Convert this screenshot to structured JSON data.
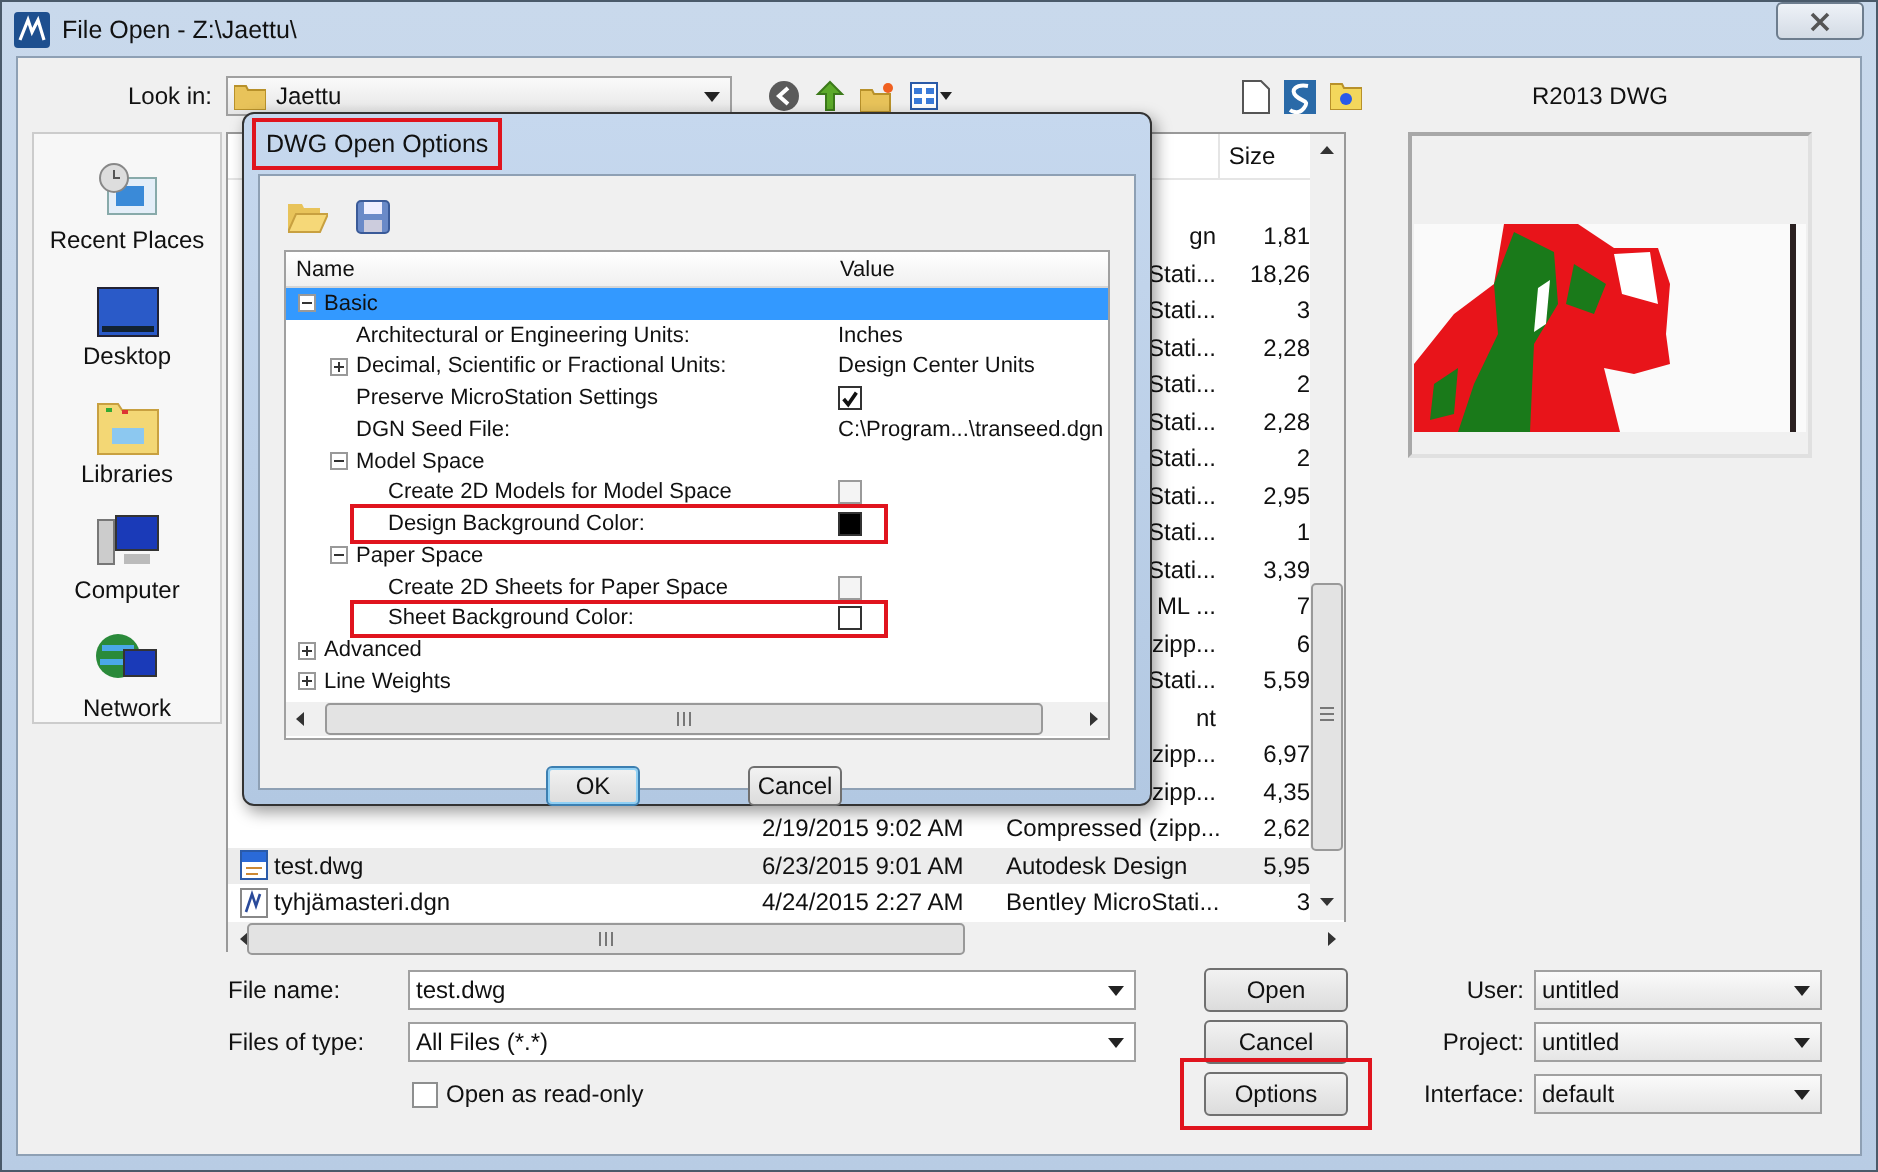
{
  "window": {
    "title": "File Open - Z:\\Jaettu\\"
  },
  "toolbar": {
    "look_in_label": "Look in:",
    "look_in_value": "Jaettu"
  },
  "places": [
    {
      "label": "Recent Places",
      "kind": "recent"
    },
    {
      "label": "Desktop",
      "kind": "desktop"
    },
    {
      "label": "Libraries",
      "kind": "libraries"
    },
    {
      "label": "Computer",
      "kind": "computer"
    },
    {
      "label": "Network",
      "kind": "network"
    }
  ],
  "file_list": {
    "size_column": "Size",
    "rows": [
      {
        "kind": "covered",
        "type": "gn",
        "size": "1,81",
        "selected": false
      },
      {
        "kind": "covered",
        "type": "Stati...",
        "size": "18,26",
        "selected": false
      },
      {
        "kind": "covered",
        "type": "Stati...",
        "size": "3",
        "selected": false
      },
      {
        "kind": "covered",
        "type": "Stati...",
        "size": "2,28",
        "selected": false
      },
      {
        "kind": "covered",
        "type": "Stati...",
        "size": "2",
        "selected": false
      },
      {
        "kind": "covered",
        "type": "Stati...",
        "size": "2,28",
        "selected": false
      },
      {
        "kind": "covered",
        "type": "Stati...",
        "size": "2",
        "selected": false
      },
      {
        "kind": "covered",
        "type": "Stati...",
        "size": "2,95",
        "selected": false
      },
      {
        "kind": "covered",
        "type": "Stati...",
        "size": "1",
        "selected": false
      },
      {
        "kind": "covered",
        "type": "Stati...",
        "size": "3,39",
        "selected": false
      },
      {
        "kind": "covered",
        "type": "ML ...",
        "size": "7",
        "selected": false
      },
      {
        "kind": "covered",
        "type": "zipp...",
        "size": "6",
        "selected": false
      },
      {
        "kind": "covered",
        "type": "Stati...",
        "size": "5,59",
        "selected": false
      },
      {
        "kind": "covered",
        "type": "nt",
        "selected": false
      },
      {
        "kind": "covered",
        "type": "zipp...",
        "size": "6,97",
        "selected": false
      },
      {
        "kind": "covered",
        "type": "zipp...",
        "size": "4,35",
        "selected": false
      },
      {
        "kind": "file",
        "date": "2/19/2015 9:02 AM",
        "type": "Compressed (zipp...",
        "size": "2,62",
        "selected": false
      },
      {
        "kind": "dwg",
        "name": "test.dwg",
        "date": "6/23/2015 9:01 AM",
        "type": "Autodesk Design",
        "size": "5,95",
        "selected": true
      },
      {
        "kind": "dgn",
        "name": "tyhjämasteri.dgn",
        "date": "4/24/2015 2:27 AM",
        "type": "Bentley MicroStati...",
        "size": "3",
        "selected": false
      }
    ]
  },
  "preview": {
    "label": "R2013 DWG"
  },
  "form": {
    "file_name": {
      "label": "File name:",
      "value": "test.dwg"
    },
    "file_type": {
      "label": "Files of type:",
      "value": "All Files (*.*)"
    },
    "read_only": {
      "label": "Open as read-only",
      "checked": false
    }
  },
  "buttons": [
    {
      "label": "Open",
      "highlighted": false
    },
    {
      "label": "Cancel",
      "highlighted": false
    },
    {
      "label": "Options",
      "highlighted": true
    }
  ],
  "settings": [
    {
      "label": "User:",
      "value": "untitled"
    },
    {
      "label": "Project:",
      "value": "untitled"
    },
    {
      "label": "Interface:",
      "value": "default"
    }
  ],
  "dialog": {
    "title": "DWG Open Options",
    "title_highlighted": true,
    "columns": [
      "Name",
      "Value"
    ],
    "tree": [
      {
        "label": "Basic",
        "expanded": true,
        "selected": true,
        "highlighted": false,
        "children": [
          {
            "label": "Architectural or Engineering Units:",
            "selected": false,
            "highlighted": false,
            "value": {
              "kind": "text",
              "text": "Inches"
            }
          },
          {
            "label": "Decimal, Scientific or Fractional Units:",
            "expanded": false,
            "selected": false,
            "highlighted": false,
            "value": {
              "kind": "text",
              "text": "Design Center Units"
            }
          },
          {
            "label": "Preserve MicroStation Settings",
            "selected": false,
            "highlighted": false,
            "value": {
              "kind": "checkbox",
              "checked": true,
              "disabled": false
            }
          },
          {
            "label": "DGN Seed File:",
            "selected": false,
            "highlighted": false,
            "value": {
              "kind": "text",
              "text": "C:\\Program...\\transeed.dgn"
            }
          },
          {
            "label": "Model Space",
            "expanded": true,
            "selected": false,
            "highlighted": false,
            "children": [
              {
                "label": "Create 2D Models for Model Space",
                "selected": false,
                "highlighted": false,
                "value": {
                  "kind": "checkbox",
                  "checked": false,
                  "disabled": true
                }
              },
              {
                "label": "Design Background Color:",
                "selected": false,
                "highlighted": true,
                "value": {
                  "kind": "color",
                  "color": "#000000"
                }
              }
            ]
          },
          {
            "label": "Paper Space",
            "expanded": true,
            "selected": false,
            "highlighted": false,
            "children": [
              {
                "label": "Create 2D Sheets for Paper Space",
                "selected": false,
                "highlighted": false,
                "value": {
                  "kind": "checkbox",
                  "checked": false,
                  "disabled": true
                }
              },
              {
                "label": "Sheet Background Color:",
                "selected": false,
                "highlighted": true,
                "value": {
                  "kind": "color",
                  "color": "#ffffff"
                }
              }
            ]
          }
        ]
      },
      {
        "label": "Advanced",
        "expanded": false,
        "selected": false,
        "highlighted": false
      },
      {
        "label": "Line Weights",
        "expanded": false,
        "selected": false,
        "highlighted": false
      }
    ],
    "buttons": [
      {
        "label": "OK",
        "default": true
      },
      {
        "label": "Cancel",
        "default": false
      }
    ]
  }
}
